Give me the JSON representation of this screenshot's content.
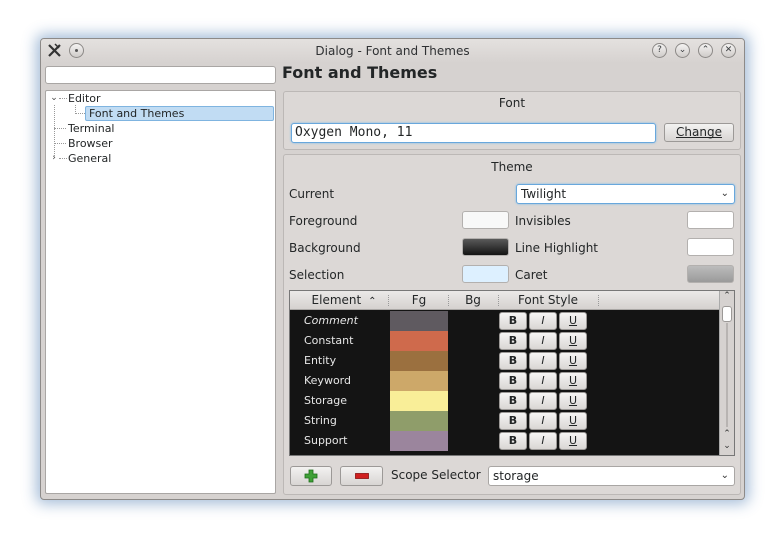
{
  "window": {
    "title": "Dialog - Font and Themes"
  },
  "search": {
    "value": ""
  },
  "page_title": "Font and Themes",
  "tree": {
    "items": [
      {
        "label": "Editor",
        "expanded": true
      },
      {
        "label": "Font and Themes",
        "selected": true
      },
      {
        "label": "Terminal"
      },
      {
        "label": "Browser"
      },
      {
        "label": "General",
        "expanded": false
      }
    ]
  },
  "font_group": {
    "title": "Font",
    "value": "Oxygen Mono, 11",
    "change_label": "Change"
  },
  "theme_group": {
    "title": "Theme",
    "current_label": "Current",
    "current_value": "Twilight",
    "foreground_label": "Foreground",
    "background_label": "Background",
    "selection_label": "Selection",
    "invisibles_label": "Invisibles",
    "line_highlight_label": "Line Highlight",
    "caret_label": "Caret",
    "colors": {
      "foreground": "#f8f8f8",
      "background": "#141414",
      "selection": "#ddf0ff",
      "invisibles": "#ffffff",
      "line_highlight": "#ffffff",
      "caret": "#a7a7a7"
    }
  },
  "table": {
    "headers": {
      "element": "Element",
      "fg": "Fg",
      "bg": "Bg",
      "font_style": "Font Style"
    },
    "bold_label": "B",
    "italic_label": "I",
    "underline_label": "U",
    "rows": [
      {
        "name": "Comment",
        "fg": "#5f5a60",
        "italic": true
      },
      {
        "name": "Constant",
        "fg": "#cf6a4c"
      },
      {
        "name": "Entity",
        "fg": "#9b703f"
      },
      {
        "name": "Keyword",
        "fg": "#cda869"
      },
      {
        "name": "Storage",
        "fg": "#f9ee98"
      },
      {
        "name": "String",
        "fg": "#8f9d6a"
      },
      {
        "name": "Support",
        "fg": "#9b859d"
      }
    ]
  },
  "bottom": {
    "scope_selector_label": "Scope Selector",
    "scope_value": "storage",
    "add_icon_color": "#3fa037",
    "remove_icon_color": "#d02020"
  }
}
